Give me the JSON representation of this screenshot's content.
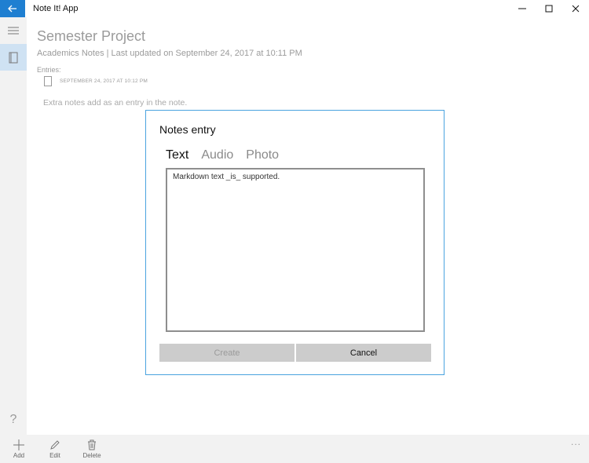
{
  "window": {
    "app_title": "Note It! App",
    "back_icon": "arrow-left-icon",
    "accent_color": "#1f7fd1"
  },
  "rail": {
    "menu_icon": "hamburger-icon",
    "notebook_icon": "notebook-icon",
    "help_label": "?"
  },
  "note": {
    "title": "Semester Project",
    "subtitle": "Academics Notes | Last updated on September 24, 2017 at 10:11 PM",
    "entries_label": "Entries:",
    "entries": [
      {
        "date": "SEPTEMBER 24, 2017 AT 10:12 PM",
        "icon": "document-icon"
      }
    ],
    "extra_note": "Extra notes add as an entry in the note."
  },
  "dialog": {
    "title": "Notes entry",
    "tabs": [
      {
        "label": "Text",
        "active": true
      },
      {
        "label": "Audio",
        "active": false
      },
      {
        "label": "Photo",
        "active": false
      }
    ],
    "text_value": "Markdown text _is_ supported.",
    "create_label": "Create",
    "cancel_label": "Cancel",
    "border_color": "#4aa3df"
  },
  "commands": {
    "add_label": "Add",
    "edit_label": "Edit",
    "delete_label": "Delete",
    "more_label": "..."
  }
}
